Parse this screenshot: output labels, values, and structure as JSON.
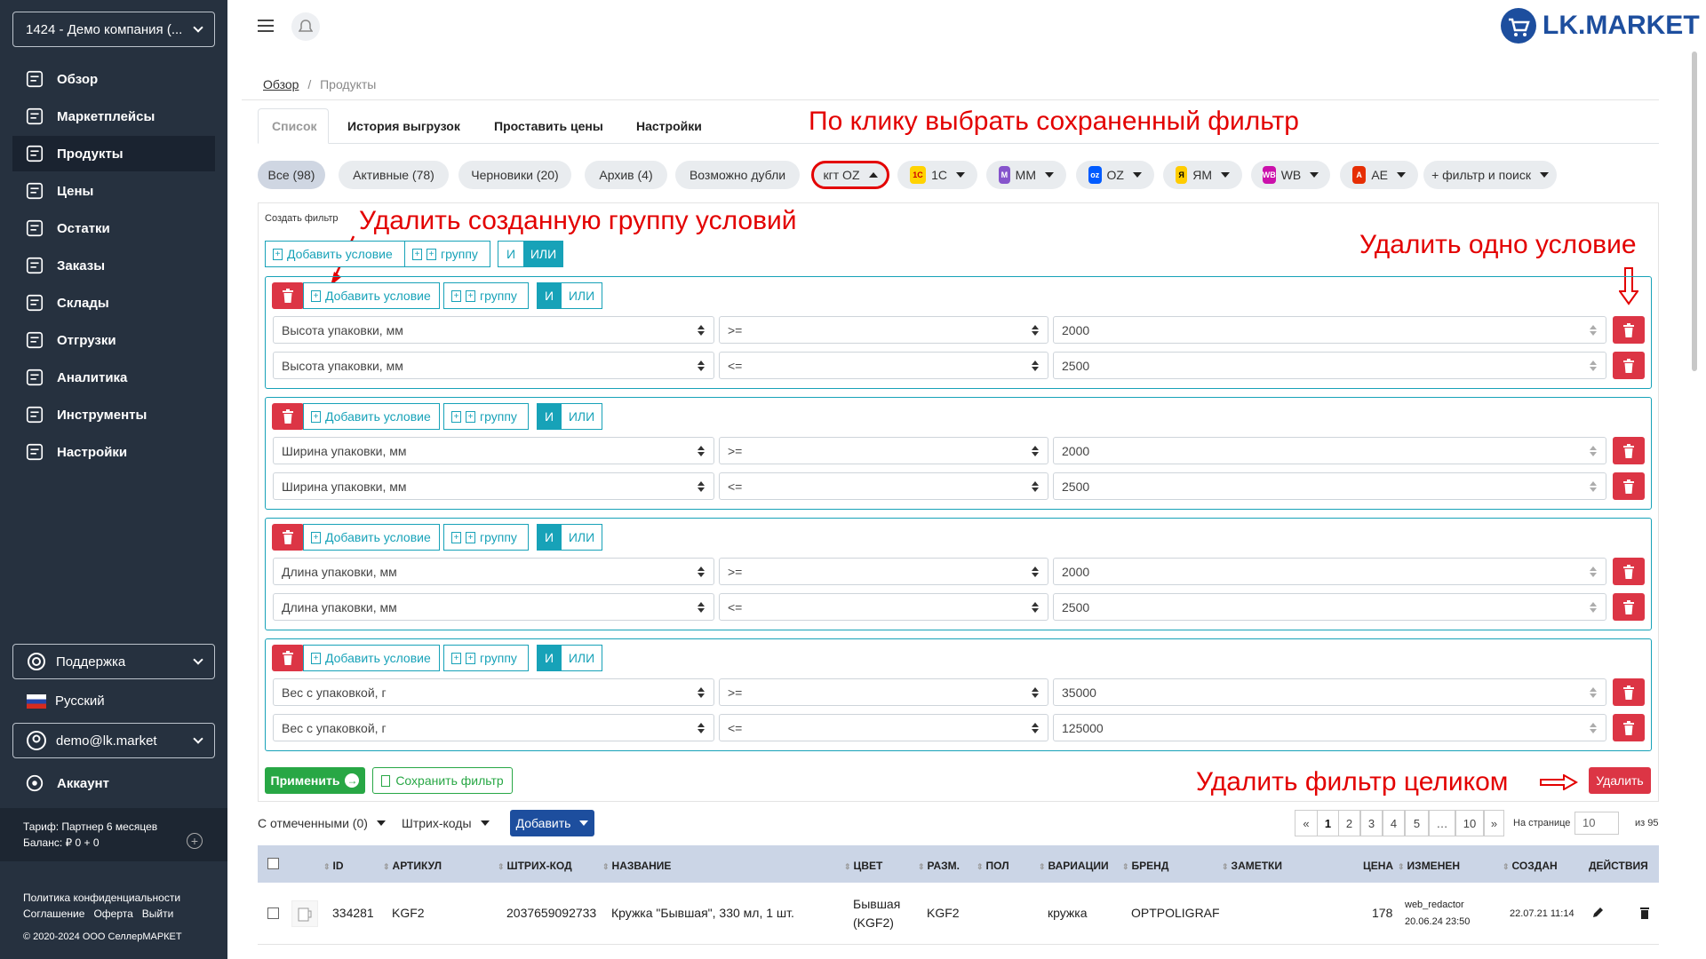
{
  "sidebar": {
    "company": "1424 - Демо компания (...",
    "nav": [
      {
        "label": "Обзор",
        "icon": "overview-icon"
      },
      {
        "label": "Маркетплейсы",
        "icon": "marketplaces-icon"
      },
      {
        "label": "Продукты",
        "icon": "products-icon"
      },
      {
        "label": "Цены",
        "icon": "prices-icon"
      },
      {
        "label": "Остатки",
        "icon": "stock-icon"
      },
      {
        "label": "Заказы",
        "icon": "orders-icon"
      },
      {
        "label": "Склады",
        "icon": "warehouse-icon"
      },
      {
        "label": "Отгрузки",
        "icon": "shipments-icon"
      },
      {
        "label": "Аналитика",
        "icon": "analytics-icon"
      },
      {
        "label": "Инструменты",
        "icon": "tools-icon"
      },
      {
        "label": "Настройки",
        "icon": "settings-icon"
      }
    ],
    "support": "Поддержка",
    "language": "Русский",
    "user": "demo@lk.market",
    "account": "Аккаунт",
    "tariff": "Тариф: Партнер 6 месяцев",
    "balance": "Баланс: ₽ 0 + 0",
    "policy": "Политика конфиденциальности",
    "agreement": "Соглашение",
    "offer": "Оферта",
    "logout": "Выйти",
    "copyright": "© 2020-2024 ООО СеллерМАРКЕТ"
  },
  "header": {
    "logo": "LK.MARKET"
  },
  "breadcrumb": {
    "home": "Обзор",
    "sep": "/",
    "current": "Продукты"
  },
  "tabs": [
    "Список",
    "История выгрузок",
    "Проставить цены",
    "Настройки"
  ],
  "pills": [
    "Все (98)",
    "Активные (78)",
    "Черновики (20)",
    "Архив (4)",
    "Возможно дубли",
    "кгт OZ",
    "1C",
    "MM",
    "OZ",
    "ЯМ",
    "WB",
    "AE",
    "+ фильтр и поиск"
  ],
  "filter": {
    "title": "Создать фильтр",
    "add_condition": "Добавить условие",
    "add_group": "группу",
    "and": "И",
    "or": "ИЛИ",
    "groups": [
      {
        "rows": [
          [
            "Высота упаковки, мм",
            ">=",
            "2000"
          ],
          [
            "Высота упаковки, мм",
            "<=",
            "2500"
          ]
        ]
      },
      {
        "rows": [
          [
            "Ширина упаковки, мм",
            ">=",
            "2000"
          ],
          [
            "Ширина упаковки, мм",
            "<=",
            "2500"
          ]
        ]
      },
      {
        "rows": [
          [
            "Длина упаковки, мм",
            ">=",
            "2000"
          ],
          [
            "Длина упаковки, мм",
            "<=",
            "2500"
          ]
        ]
      },
      {
        "rows": [
          [
            "Вес с упаковкой, г",
            ">=",
            "35000"
          ],
          [
            "Вес с упаковкой, г",
            "<=",
            "125000"
          ]
        ]
      }
    ],
    "apply": "Применить",
    "save": "Сохранить фильтр",
    "delete": "Удалить"
  },
  "annotations": {
    "choose_saved": "По клику выбрать сохраненный фильтр",
    "delete_group": "Удалить созданную группу условий",
    "delete_one": "Удалить одно условие",
    "delete_filter": "Удалить фильтр целиком"
  },
  "toolbar": {
    "with_selected": "С отмеченными (0)",
    "barcodes": "Штрих-коды",
    "add": "Добавить",
    "pages": [
      "«",
      "1",
      "2",
      "3",
      "4",
      "5",
      "…",
      "10",
      "»"
    ],
    "per_page_label": "На странице",
    "per_page": "10",
    "total": "из 95"
  },
  "table": {
    "headers": [
      "ID",
      "АРТИКУЛ",
      "ШТРИХ-КОД",
      "НАЗВАНИЕ",
      "ЦВЕТ",
      "РАЗМ.",
      "ПОЛ",
      "ВАРИАЦИИ",
      "БРЕНД",
      "ЗАМЕТКИ",
      "ЦЕНА",
      "ИЗМЕНЕН",
      "СОЗДАН",
      "ДЕЙСТВИЯ"
    ],
    "row": {
      "id": "334281",
      "article": "KGF2",
      "barcode": "2037659092733",
      "name": "Кружка \"Бывшая\", 330 мл, 1 шт.",
      "color1": "Бывшая",
      "color2": "(KGF2)",
      "size": "KGF2",
      "gender": "",
      "variation": "кружка",
      "brand": "OPTPOLIGRAF",
      "notes": "",
      "price": "178",
      "changed_by": "web_redactor",
      "changed_at": "20.06.24 23:50",
      "created": "22.07.21 11:14"
    }
  },
  "colors": {
    "teal": "#17a2b8",
    "red": "#dc3545",
    "green": "#28a745",
    "navy": "#1d4e9e",
    "sidebar": "#26313f"
  }
}
